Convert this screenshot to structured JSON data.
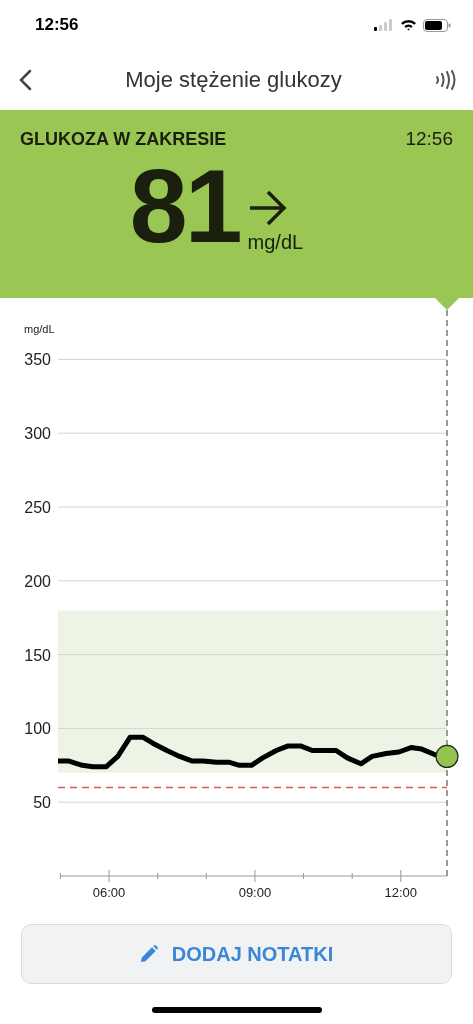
{
  "status_bar": {
    "time": "12:56"
  },
  "nav": {
    "title": "Moje stężenie glukozy"
  },
  "reading": {
    "status": "GLUKOZA W ZAKRESIE",
    "time": "12:56",
    "value": "81",
    "unit": "mg/dL"
  },
  "chart": {
    "chart_data": {
      "type": "line",
      "ylabel": "mg/dL",
      "ylim": [
        0,
        350
      ],
      "yticks": [
        50,
        100,
        150,
        200,
        250,
        300,
        350
      ],
      "xlim": [
        4.95,
        12.95
      ],
      "xticks": [
        {
          "value": 6,
          "label": "06:00"
        },
        {
          "value": 9,
          "label": "09:00"
        },
        {
          "value": 12,
          "label": "12:00"
        }
      ],
      "x": [
        4.95,
        5.16,
        5.45,
        5.67,
        5.94,
        6.18,
        6.43,
        6.7,
        6.9,
        7.19,
        7.45,
        7.7,
        7.93,
        8.21,
        8.48,
        8.68,
        8.93,
        9.16,
        9.44,
        9.67,
        9.95,
        10.18,
        10.67,
        10.9,
        11.18,
        11.41,
        11.7,
        11.96,
        12.21,
        12.43,
        12.72,
        12.95
      ],
      "grid": true,
      "series": [
        {
          "color": "#000000",
          "values": [
            78,
            78,
            75,
            74,
            74,
            81,
            94,
            94,
            90,
            85,
            81,
            78,
            78,
            77,
            77,
            75,
            75,
            80,
            85,
            88,
            88,
            85,
            85,
            80,
            76,
            81,
            83,
            84,
            87,
            86,
            82,
            81
          ]
        }
      ],
      "bands": [
        {
          "axis": "y",
          "from": 70,
          "to": 180,
          "color": "#eef4e5"
        }
      ],
      "ref_lines": [
        {
          "axis": "y",
          "value": 60,
          "color": "#e05555"
        }
      ]
    }
  },
  "button": {
    "label": "DODAJ NOTATKI"
  }
}
